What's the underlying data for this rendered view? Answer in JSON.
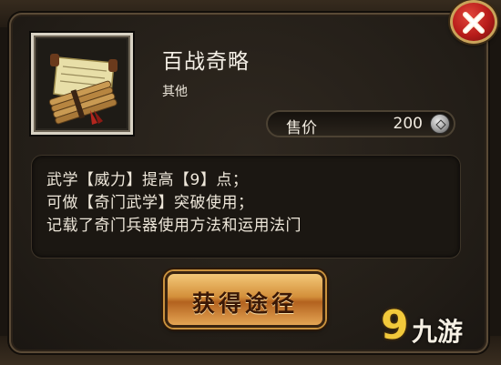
{
  "item": {
    "name": "百战奇略",
    "type": "其他",
    "icon": "scroll-bundle-icon"
  },
  "price": {
    "label": "售价",
    "value": "200",
    "currency_icon": "silver-coin-icon"
  },
  "description": {
    "lines": [
      "武学【威力】提高【9】点；",
      "可做【奇门武学】突破使用；",
      "记载了奇门兵器使用方法和运用法门"
    ]
  },
  "actions": {
    "obtain_label": "获得途径",
    "close_icon": "close-icon"
  },
  "watermark": {
    "nine": "9",
    "text": "九游"
  },
  "colors": {
    "close_red": "#b71c1a",
    "button_gold": "#d38f3a",
    "text_light": "#f4efe6"
  }
}
